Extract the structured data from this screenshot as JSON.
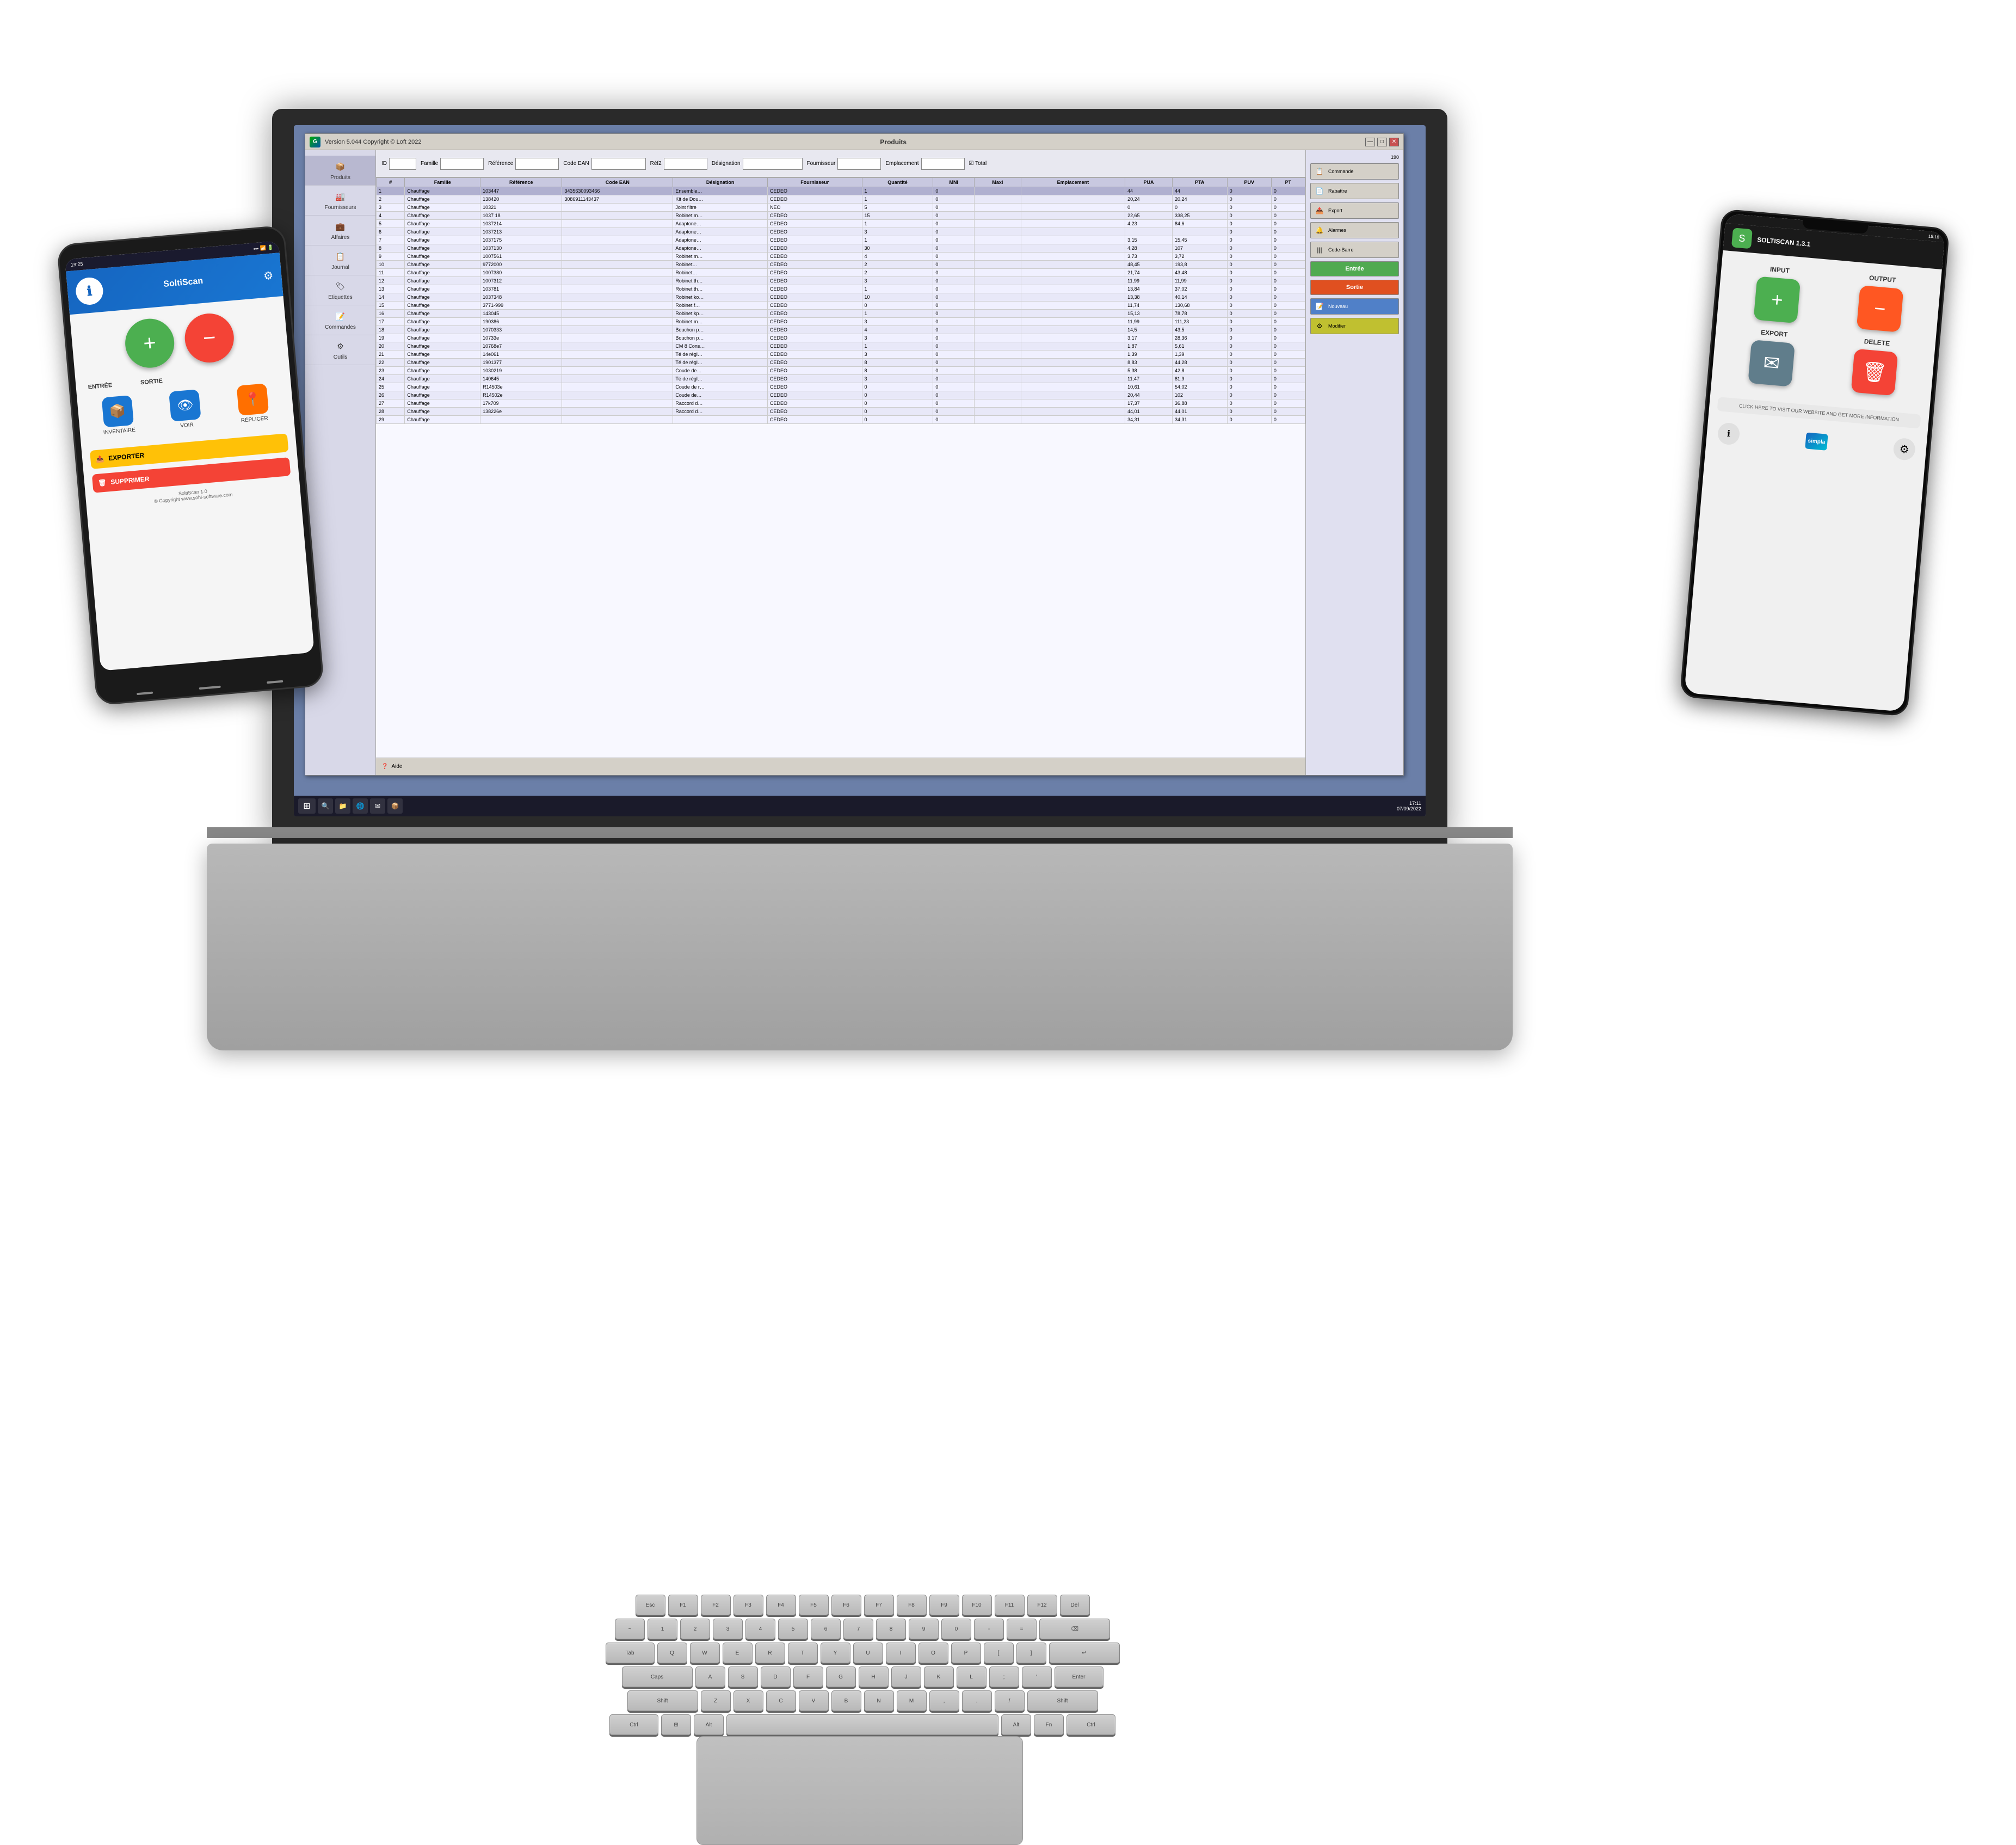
{
  "app": {
    "title": "GSM",
    "version": "Version 5.044  Copyright © Loft 2022",
    "window_title": "Produits",
    "minimize": "—",
    "maximize": "□",
    "close": "✕"
  },
  "sidebar": {
    "items": [
      {
        "label": "Produits",
        "icon": "📦"
      },
      {
        "label": "Fournisseurs",
        "icon": "🏭"
      },
      {
        "label": "Affaires",
        "icon": "💼"
      },
      {
        "label": "Journal",
        "icon": "📋"
      },
      {
        "label": "Etiquettes",
        "icon": "🏷"
      },
      {
        "label": "Commandes",
        "icon": "📝"
      },
      {
        "label": "Outils",
        "icon": "⚙"
      }
    ]
  },
  "toolbar": {
    "fields": [
      "ID",
      "Famille",
      "Référence",
      "Code EAN",
      "Réf2",
      "Désignation",
      "Fournisseur",
      "Emplacement"
    ],
    "total_label": "Total"
  },
  "table": {
    "headers": [
      "#",
      "Famille",
      "Référence",
      "Code EAN",
      "Désignation",
      "Fournisseur",
      "Quantité",
      "MNI",
      "Maxi",
      "Emplacement",
      "PUA",
      "PTA",
      "PUV",
      "PT"
    ],
    "rows": [
      [
        "1",
        "Chauffage",
        "103447",
        "3435630093466",
        "Ensemble…",
        "CEDEO",
        "1",
        "0",
        "",
        "",
        "44",
        "44",
        "0",
        "0"
      ],
      [
        "2",
        "Chauffage",
        "138420",
        "3086911143437",
        "Kit de Dou…",
        "CEDEO",
        "1",
        "0",
        "",
        "",
        "20,24",
        "20,24",
        "0",
        "0"
      ],
      [
        "3",
        "Chauffage",
        "10321",
        "",
        "Joint filtre",
        "NEO",
        "5",
        "0",
        "",
        "",
        "0",
        "0",
        "0",
        "0"
      ],
      [
        "4",
        "Chauffage",
        "1037 18",
        "",
        "Robinet m…",
        "CEDEO",
        "15",
        "0",
        "",
        "",
        "22,65",
        "338,25",
        "0",
        "0"
      ],
      [
        "5",
        "Chauffage",
        "1037214",
        "",
        "Adaptone…",
        "CEDEO",
        "1",
        "0",
        "",
        "",
        "4,23",
        "84,6",
        "0",
        "0"
      ],
      [
        "6",
        "Chauffage",
        "1037213",
        "",
        "Adaptone…",
        "CEDEO",
        "3",
        "0",
        "",
        "",
        "",
        "",
        "0",
        "0"
      ],
      [
        "7",
        "Chauffage",
        "1037175",
        "",
        "Adaptone…",
        "CEDEO",
        "1",
        "0",
        "",
        "",
        "3,15",
        "15,45",
        "0",
        "0"
      ],
      [
        "8",
        "Chauffage",
        "1037130",
        "",
        "Adaptone…",
        "CEDEO",
        "30",
        "0",
        "",
        "",
        "4,28",
        "107",
        "0",
        "0"
      ],
      [
        "9",
        "Chauffage",
        "1007561",
        "",
        "Robinet m…",
        "CEDEO",
        "4",
        "0",
        "",
        "",
        "3,73",
        "3,72",
        "0",
        "0"
      ],
      [
        "10",
        "Chauffage",
        "9772000",
        "",
        "Robinet…",
        "CEDEO",
        "2",
        "0",
        "",
        "",
        "48,45",
        "193,8",
        "0",
        "0"
      ],
      [
        "11",
        "Chauffage",
        "1007380",
        "",
        "Robinet…",
        "CEDEO",
        "2",
        "0",
        "",
        "",
        "21,74",
        "43,48",
        "0",
        "0"
      ],
      [
        "12",
        "Chauffage",
        "1007312",
        "",
        "Robinet th…",
        "CEDEO",
        "3",
        "0",
        "",
        "",
        "11,99",
        "11,99",
        "0",
        "0"
      ],
      [
        "13",
        "Chauffage",
        "103781",
        "",
        "Robinet th…",
        "CEDEO",
        "1",
        "0",
        "",
        "",
        "13,84",
        "37,02",
        "0",
        "0"
      ],
      [
        "14",
        "Chauffage",
        "1037348",
        "",
        "Robinet ko…",
        "CEDEO",
        "10",
        "0",
        "",
        "",
        "13,38",
        "40,14",
        "0",
        "0"
      ],
      [
        "15",
        "Chauffage",
        "3771-999",
        "",
        "Robinet f…",
        "CEDEO",
        "0",
        "0",
        "",
        "",
        "11,74",
        "130,68",
        "0",
        "0"
      ],
      [
        "16",
        "Chauffage",
        "143045",
        "",
        "Robinet kp…",
        "CEDEO",
        "1",
        "0",
        "",
        "",
        "15,13",
        "78,78",
        "0",
        "0"
      ],
      [
        "17",
        "Chauffage",
        "190386",
        "",
        "Robinet m…",
        "CEDEO",
        "3",
        "0",
        "",
        "",
        "11,99",
        "111,23",
        "0",
        "0"
      ],
      [
        "18",
        "Chauffage",
        "1070333",
        "",
        "Bouchon p…",
        "CEDEO",
        "4",
        "0",
        "",
        "",
        "14,5",
        "43,5",
        "0",
        "0"
      ],
      [
        "19",
        "Chauffage",
        "10733e",
        "",
        "Bouchon p…",
        "CEDEO",
        "3",
        "0",
        "",
        "",
        "3,17",
        "28,36",
        "0",
        "0"
      ],
      [
        "20",
        "Chauffage",
        "10768e7",
        "",
        "CM 8 Cons…",
        "CEDEO",
        "1",
        "0",
        "",
        "",
        "1,87",
        "5,61",
        "0",
        "0"
      ],
      [
        "21",
        "Chauffage",
        "14e061",
        "",
        "Té de régl…",
        "CEDEO",
        "3",
        "0",
        "",
        "",
        "1,39",
        "1,39",
        "0",
        "0"
      ],
      [
        "22",
        "Chauffage",
        "1901377",
        "",
        "Té de régl…",
        "CEDEO",
        "8",
        "0",
        "",
        "",
        "8,83",
        "44,28",
        "0",
        "0"
      ],
      [
        "23",
        "Chauffage",
        "1030219",
        "",
        "Coude de…",
        "CEDEO",
        "8",
        "0",
        "",
        "",
        "5,38",
        "42,8",
        "0",
        "0"
      ],
      [
        "24",
        "Chauffage",
        "140645",
        "",
        "Té de régl…",
        "CEDEO",
        "3",
        "0",
        "",
        "",
        "11,47",
        "81,9",
        "0",
        "0"
      ],
      [
        "25",
        "Chauffage",
        "R14503e",
        "",
        "Coude de r…",
        "CEDEO",
        "0",
        "0",
        "",
        "",
        "10,61",
        "54,02",
        "0",
        "0"
      ],
      [
        "26",
        "Chauffage",
        "R14502e",
        "",
        "Coude de…",
        "CEDEO",
        "0",
        "0",
        "",
        "",
        "20,44",
        "102",
        "0",
        "0"
      ],
      [
        "27",
        "Chauffage",
        "17k709",
        "",
        "Raccord d…",
        "CEDEO",
        "0",
        "0",
        "",
        "",
        "17,37",
        "36,88",
        "0",
        "0"
      ],
      [
        "28",
        "Chauffage",
        "138226e",
        "",
        "Raccord d…",
        "CEDEO",
        "0",
        "0",
        "",
        "",
        "44,01",
        "44,01",
        "0",
        "0"
      ],
      [
        "29",
        "Chauffage",
        "",
        "",
        "",
        "CEDEO",
        "0",
        "0",
        "",
        "",
        "34,31",
        "34,31",
        "0",
        "0"
      ]
    ]
  },
  "right_panel": {
    "section_label": "190",
    "buttons": [
      {
        "label": "Commande",
        "icon": "📋"
      },
      {
        "label": "Rabattre",
        "icon": "📄"
      },
      {
        "label": "Export",
        "icon": "📤"
      },
      {
        "label": "Alarmes",
        "icon": "🔔"
      },
      {
        "label": "Code-Barre",
        "icon": "|||"
      },
      {
        "label": "Entrée",
        "icon": "+",
        "type": "green"
      },
      {
        "label": "Sortie",
        "icon": "−",
        "type": "red"
      },
      {
        "label": "Nouveau",
        "icon": "📝",
        "type": "blue"
      },
      {
        "label": "Modifier",
        "icon": "⚙"
      }
    ]
  },
  "phone_left": {
    "time": "19:25",
    "app_name": "SoltiScan",
    "version": "SoltiScan 1.0",
    "copyright": "© Copyright www.sohi-software.com",
    "btn_add_label": "ENTRÉE",
    "btn_remove_label": "SORTIE",
    "grid_items": [
      {
        "label": "INVENTAIRE",
        "icon": "📦"
      },
      {
        "label": "VOIR",
        "icon": "👁"
      },
      {
        "label": "RÉPLICER",
        "icon": "📍"
      },
      {
        "label": "EXPORTER",
        "icon": "📤",
        "color": "yellow"
      },
      {
        "label": "SUPPRIMER",
        "icon": "🗑",
        "color": "red"
      }
    ]
  },
  "phone_right": {
    "time": "15:18",
    "app_name": "SOLTISCAN 1.3.1",
    "btn_input": "INPUT",
    "btn_output": "OUTPUT",
    "btn_export": "EXPORT",
    "btn_delete": "DELETE",
    "promo_text": "CLICK HERE TO VISIT OUR WEBSITE AND GET MORE INFORMATION",
    "logo": "simpla"
  },
  "taskbar": {
    "time": "17:11",
    "date": "07/09/2022"
  }
}
